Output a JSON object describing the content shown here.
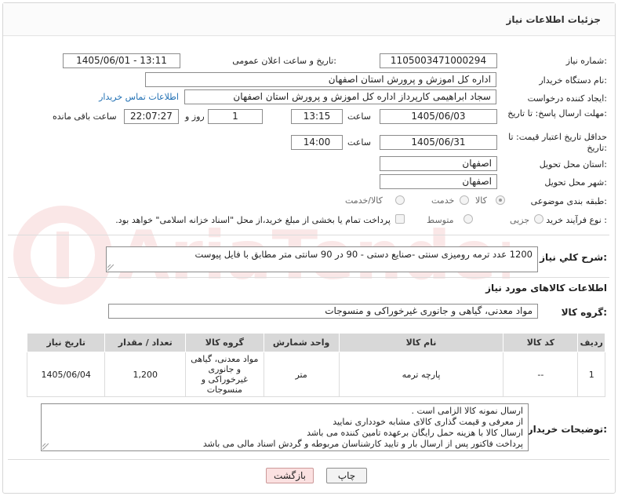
{
  "header": {
    "title": "جزئیات اطلاعات نیاز"
  },
  "labels": {
    "need_number": "شماره نیاز:",
    "announce_datetime": "تاریخ و ساعت اعلان عمومی:",
    "buyer_org": "نام دستگاه خریدار:",
    "requester": "ایجاد کننده درخواست:",
    "reply_deadline": "مهلت ارسال پاسخ: تا تاریخ:",
    "time": "ساعت",
    "day_and": "روز و",
    "remaining_time": "ساعت باقی مانده",
    "price_validity": "حداقل تاریخ اعتبار قیمت: تا تاریخ:",
    "delivery_province": "استان محل تحویل:",
    "delivery_city": "شهر محل تحویل:",
    "subject_category": "طبقه بندی موضوعی:",
    "purchase_type": "نوع فرآیند خرید :",
    "general_desc": "شرح کلي نياز:",
    "goods_info": "اطلاعات کالاهای مورد نیاز",
    "goods_group": "گروه کالا:",
    "buyer_notes": "توضیحات خریدار:"
  },
  "values": {
    "need_number": "1105003471000294",
    "announce_datetime": "1405/06/01 - 13:11",
    "buyer_org": "اداره کل اموزش و پرورش استان اصفهان",
    "requester": "سجاد ابراهیمی کارپرداز اداره کل اموزش و پرورش استان اصفهان",
    "buyer_contact_link": "اطلاعات تماس خریدار",
    "reply_date": "1405/06/03",
    "reply_time": "13:15",
    "remaining_days": "1",
    "remaining_clock": "22:07:27",
    "validity_date": "1405/06/31",
    "validity_time": "14:00",
    "province": "اصفهان",
    "city": "اصفهان",
    "general_desc": "1200 عدد ترمه رومیزی سنتی -صنایع دستی - 90 در 90 سانتی متر  مطابق با فایل پیوست",
    "goods_group": "مواد معدنی، گیاهی و جانوری غیرخوراکی و منسوجات",
    "buyer_notes": [
      "ارسال نمونه کالا الزامی است .",
      "از معرفی و قیمت گذاری  کالای مشابه خودداری نمایید",
      "ارسال کالا با هزینه حمل رایگان برعهده تامین کننده می باشد",
      "پرداخت فاکتور پس از ارسال بار و  تایید کارشناسان مربوطه و گردش اسناد مالی  می باشد"
    ]
  },
  "subject_options": [
    {
      "label": "کالا",
      "selected": true
    },
    {
      "label": "خدمت",
      "selected": false
    },
    {
      "label": "کالا/خدمت",
      "selected": false
    }
  ],
  "purchase_options": [
    {
      "label": "جزیی",
      "selected": false
    },
    {
      "label": "متوسط",
      "selected": false
    }
  ],
  "payment_note": "پرداخت تمام یا بخشی از مبلغ خرید،از محل \"اسناد خزانه اسلامی\" خواهد بود.",
  "table": {
    "headers": [
      "ردیف",
      "کد کالا",
      "نام کالا",
      "واحد شمارش",
      "گروه کالا",
      "تعداد / مقدار",
      "تاریخ نیاز"
    ],
    "rows": [
      [
        "1",
        "--",
        "پارچه ترمه",
        "متر",
        "مواد معدنی، گیاهی و جانوری غیرخوراکی و منسوجات",
        "1,200",
        "1405/06/04"
      ]
    ]
  },
  "buttons": {
    "print": "چاپ",
    "back": "بازگشت"
  },
  "watermark": "AriaTender.net",
  "colors": {
    "link": "#1f6fb3",
    "back_button": "#fbe1e1",
    "table_header": "#d8d8d8"
  }
}
